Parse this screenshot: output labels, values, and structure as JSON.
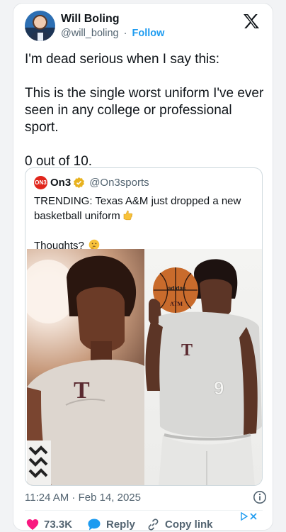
{
  "author": {
    "name": "Will Boling",
    "handle": "@will_boling",
    "separator": "·",
    "follow": "Follow"
  },
  "tweet": {
    "lines": [
      "I'm dead serious when I say this:",
      "This is the single worst uniform I've ever seen in any college or professional sport.",
      "0 out of 10."
    ]
  },
  "quote": {
    "logo_text": "ON3",
    "name": "On3",
    "handle": "@On3sports",
    "line1": "TRENDING: Texas A&M just dropped a new basketball uniform",
    "line2": "Thoughts?",
    "jersey_letter": "T",
    "jersey_number": "9",
    "ball_logo": "adidas",
    "ball_text": "ATM"
  },
  "meta": {
    "timestamp": "11:24 AM · Feb 14, 2025"
  },
  "actions": {
    "likes": "73.3K",
    "reply": "Reply",
    "copy": "Copy link"
  },
  "colors": {
    "accent": "#1d9bf0",
    "like": "#f91880",
    "muted": "#536471",
    "text": "#0f1419"
  },
  "icons": [
    "x-logo-icon",
    "verified-badge-icon",
    "point-hand-emoji-icon",
    "thinking-emoji-icon",
    "info-icon",
    "heart-icon",
    "reply-bubble-icon",
    "link-icon",
    "ad-choices-icon"
  ]
}
